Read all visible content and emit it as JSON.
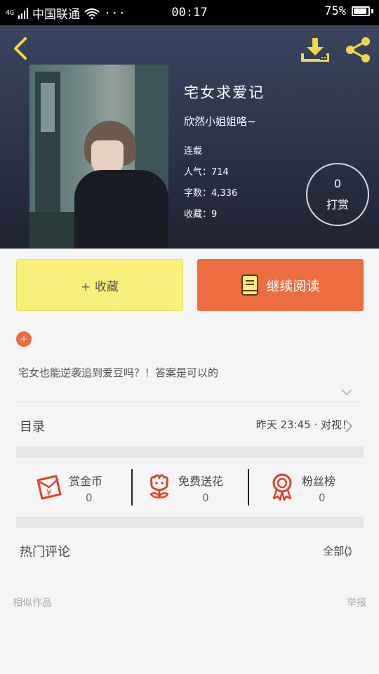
{
  "status_bar": {
    "signal": "4G",
    "carrier": "中国联通",
    "more": "···",
    "time": "00:17",
    "battery": "75%"
  },
  "book": {
    "title": "宅女求爱记",
    "author": "欣然小姐姐咯~",
    "status": "连载",
    "popularity": "人气：714",
    "word_count": "字数：4,336",
    "favorites": "收藏：9"
  },
  "reward": {
    "count": "0",
    "label": "打赏"
  },
  "actions": {
    "collect_label": "+ 收藏",
    "read_label": "继续阅读"
  },
  "description": {
    "add_badge": "+",
    "text": "宅女也能逆袭追到爱豆吗？！答案是可以的"
  },
  "toc": {
    "label": "目录",
    "latest": "昨天 23:45 · 对视！"
  },
  "stats": [
    {
      "icon": "red-envelope-icon",
      "label": "赏金币",
      "value": "0"
    },
    {
      "icon": "flower-icon",
      "label": "免费送花",
      "value": "0"
    },
    {
      "icon": "medal-icon",
      "label": "粉丝榜",
      "value": "0"
    }
  ],
  "comments": {
    "label": "热门评论",
    "all_label": "全部()"
  },
  "footer": {
    "similar": "相似作品",
    "report": "举报"
  },
  "colors": {
    "accent_orange": "#ec6d3f",
    "accent_yellow": "#f8f07c",
    "icon_yellow": "#f0d64a",
    "icon_red": "#d8442c"
  }
}
